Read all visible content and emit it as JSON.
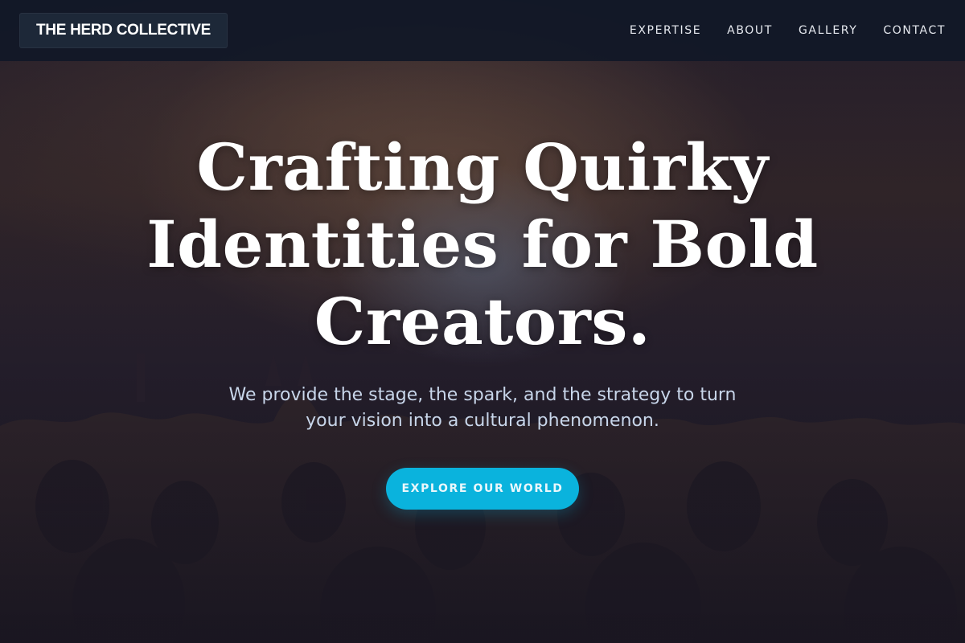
{
  "brand": {
    "name": "THE HERD COLLECTIVE"
  },
  "nav": {
    "items": [
      {
        "label": "EXPERTISE"
      },
      {
        "label": "ABOUT"
      },
      {
        "label": "GALLERY"
      },
      {
        "label": "CONTACT"
      }
    ]
  },
  "hero": {
    "headline": "Crafting Quirky Identities for Bold Creators.",
    "subtext": "We provide the stage, the spark, and the strategy to turn your vision into a cultural phenomenon.",
    "cta_label": "EXPLORE OUR WORLD",
    "background_image": "concert-crowd-photo"
  },
  "colors": {
    "navbar_bg": "#111827",
    "brand_bg": "#1d2838",
    "accent": "#0ab3dd",
    "subtext": "#c8d6ea",
    "headline": "#ffffff"
  }
}
